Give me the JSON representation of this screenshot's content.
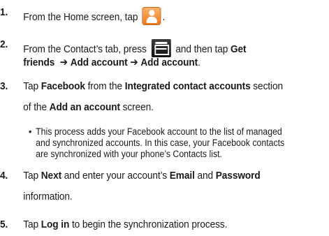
{
  "steps": [
    {
      "num": "1.",
      "t1": "From the Home screen, tap",
      "t2": "."
    },
    {
      "num": "2.",
      "t1": "From the Contact’s tab, press",
      "t2": "and then tap",
      "b1": "Get",
      "b2": "friends",
      "arrow1": "➔",
      "b3": "Add account",
      "arrow2": "➔",
      "b4": "Add account",
      "t3": "."
    },
    {
      "num": "3.",
      "t1": "Tap",
      "b1": "Facebook",
      "t2": "from the",
      "b2": "Integrated contact accounts",
      "t3": "section",
      "t4": "of the",
      "b3": "Add an account",
      "t5": "screen."
    },
    {
      "num": "4.",
      "t1": "Tap",
      "b1": "Next",
      "t2": "and enter your account’s",
      "b2": "Email",
      "t3": "and",
      "b3": "Password",
      "t4": "information."
    },
    {
      "num": "5.",
      "t1": "Tap",
      "b1": "Log in",
      "t2": "to begin the synchronization process."
    }
  ],
  "note": {
    "bullet": "•",
    "lines": [
      "This process adds your Facebook account to the list of managed",
      "and synchronized accounts. In this case, your Facebook contacts",
      "are synchronized with your phone’s Contacts list."
    ]
  },
  "icons": {
    "contacts": "contacts-app-icon",
    "menu": "menu-key-icon",
    "contacts_color": "#f28a2a",
    "menu_color": "#1e1e1e"
  }
}
